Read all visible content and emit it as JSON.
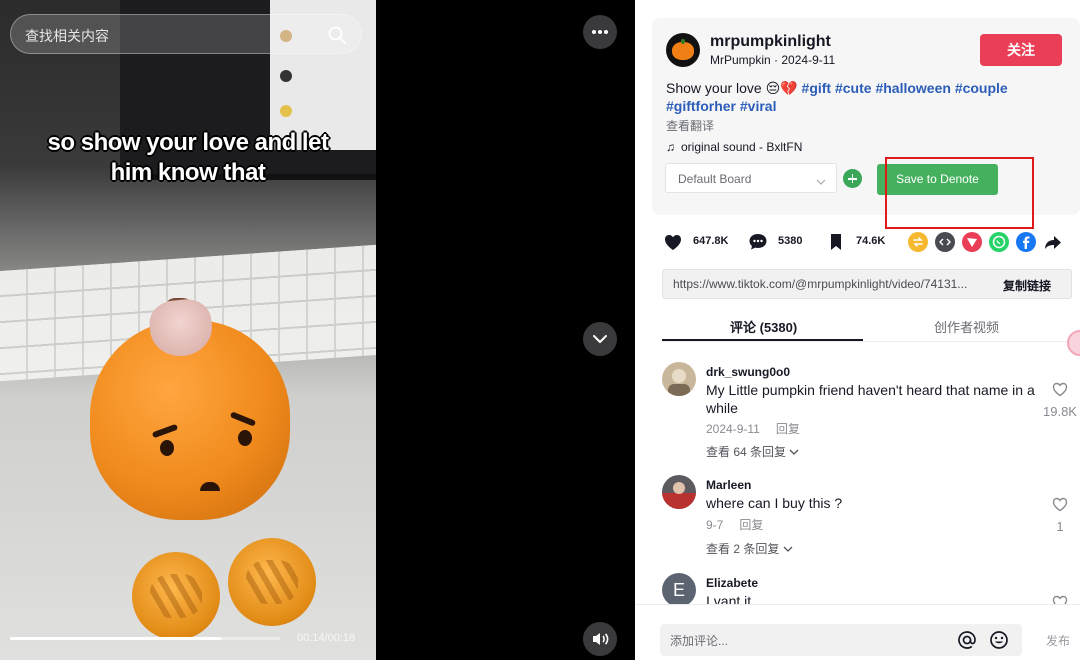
{
  "video": {
    "search_placeholder": "查找相关内容",
    "caption_line1": "so show your love and let",
    "caption_line2": "him know that",
    "time": "00:14/00:18",
    "progress_fraction": 0.78
  },
  "author": {
    "username": "mrpumpkinlight",
    "nickname": "MrPumpkin",
    "date": "2024-9-11",
    "follow_label": "关注"
  },
  "description": {
    "text": "Show your love 😔💔",
    "hashtags": [
      "#gift",
      "#cute",
      "#halloween",
      "#couple",
      "#giftforher",
      "#viral"
    ],
    "translate_label": "查看翻译"
  },
  "sound": {
    "label": "original sound - BxltFN"
  },
  "board": {
    "selected": "Default Board",
    "save_label": "Save to Denote"
  },
  "stats": {
    "likes": "647.8K",
    "comments": "5380",
    "saves": "74.6K"
  },
  "share_icons": [
    {
      "name": "repost-icon",
      "color": "#f5b82e"
    },
    {
      "name": "embed-icon",
      "color": "#4a4b52"
    },
    {
      "name": "send-icon",
      "color": "#ea3e57"
    },
    {
      "name": "whatsapp-icon",
      "color": "#25d366"
    },
    {
      "name": "facebook-icon",
      "color": "#1877f2"
    },
    {
      "name": "share-arrow-icon",
      "color": "#161823"
    }
  ],
  "link": {
    "url": "https://www.tiktok.com/@mrpumpkinlight/video/74131...",
    "copy_label": "复制链接"
  },
  "tabs": {
    "comments": "评论 (5380)",
    "creator_videos": "创作者视频"
  },
  "comments": [
    {
      "name": "drk_swung0o0",
      "text": "My Little pumpkin friend haven't heard that name in a while",
      "date": "2024-9-11",
      "reply": "回复",
      "more": "查看 64 条回复",
      "likes": "19.8K"
    },
    {
      "name": "Marleen",
      "text": "where can I buy this ?",
      "date": "9-7",
      "reply": "回复",
      "more": "查看 2 条回复",
      "likes": "1"
    },
    {
      "name": "Elizabete",
      "initial": "E",
      "text": "I vant it"
    }
  ],
  "comment_bar": {
    "placeholder": "添加评论...",
    "post_label": "发布"
  },
  "colors": {
    "follow": "#ea3e57",
    "save": "#45b15f",
    "highlight": "#e01a1a",
    "hashtag": "#2b5db8"
  }
}
